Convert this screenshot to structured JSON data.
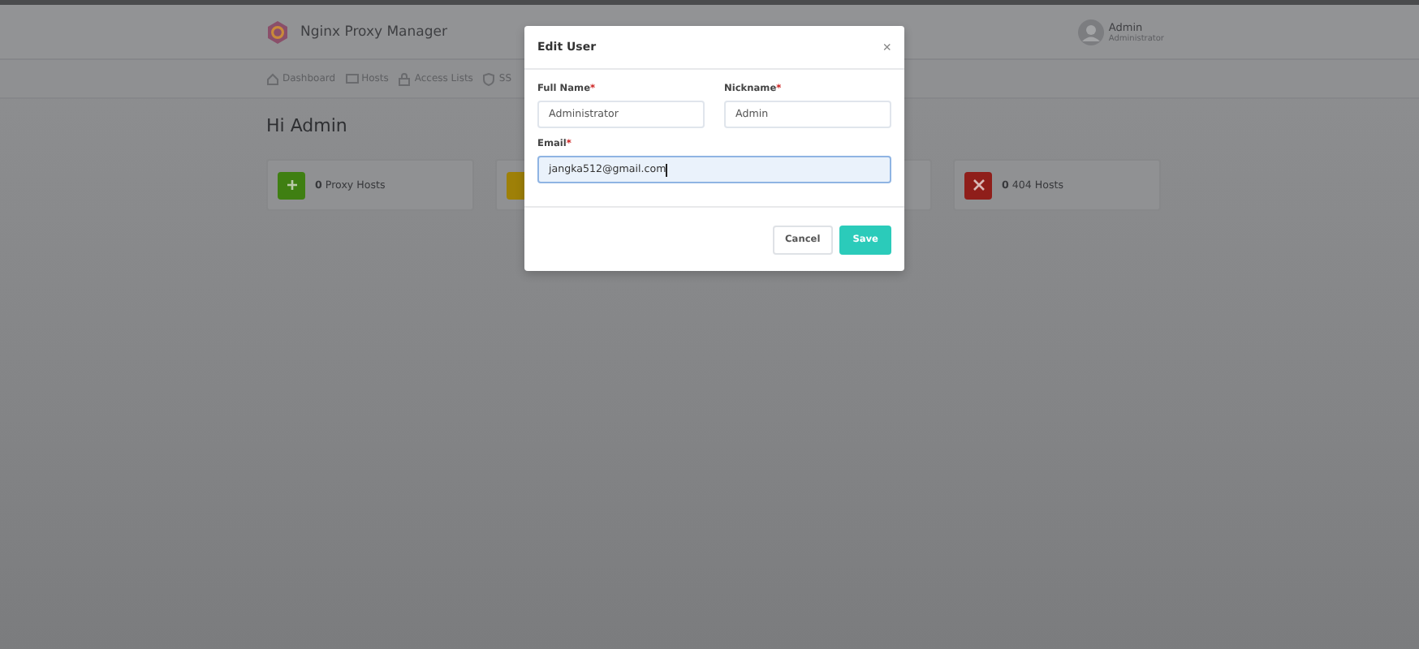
{
  "app": {
    "title": "Nginx Proxy Manager"
  },
  "user": {
    "name": "Admin",
    "role": "Administrator"
  },
  "nav": [
    {
      "label": "Dashboard"
    },
    {
      "label": "Hosts"
    },
    {
      "label": "Access Lists"
    },
    {
      "label": "SS"
    }
  ],
  "greeting": "Hi Admin",
  "cards": [
    {
      "kind": "stat",
      "color": "#3f7f12",
      "count": "0",
      "label": "Proxy Hosts"
    },
    {
      "kind": "stat",
      "color": "#9e8008"
    },
    {
      "kind": "stat"
    },
    {
      "kind": "stat",
      "color": "#8f1e1a",
      "count": "0",
      "label": "404 Hosts"
    }
  ],
  "modal": {
    "title": "Edit User",
    "close": "×",
    "fields": [
      {
        "label": "Full Name",
        "required_mark": "*",
        "value": "Administrator",
        "focused": false
      },
      {
        "label": "Nickname",
        "required_mark": "*",
        "value": "Admin",
        "focused": false
      },
      {
        "label": "Email",
        "required_mark": "*",
        "value": "jangka512@gmail.com",
        "focused": true
      }
    ],
    "buttons": [
      {
        "label": "Cancel",
        "kind": "secondary"
      },
      {
        "label": "Save",
        "kind": "primary"
      }
    ]
  }
}
